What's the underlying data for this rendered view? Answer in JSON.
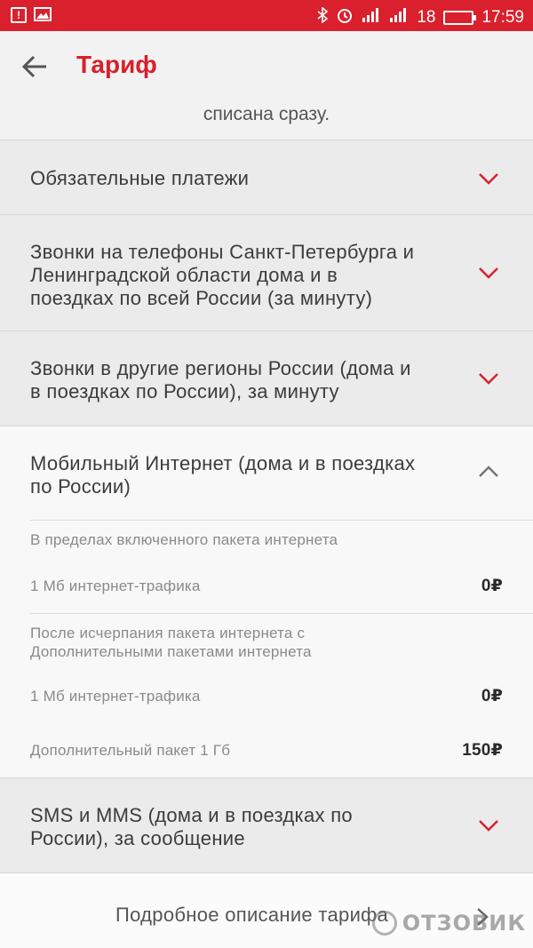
{
  "status_bar": {
    "signal": "18",
    "time": "17:59"
  },
  "header": {
    "title": "Тариф"
  },
  "cut_text": "списана сразу.",
  "sections": [
    {
      "label_line1": "Обязательные платежи",
      "label_line2": "",
      "label_line3": "",
      "state": "collapsed"
    },
    {
      "label_line1": "Звонки на телефоны Санкт-Петербурга и",
      "label_line2": "Ленинградской области дома и в",
      "label_line3": "поездках по всей России (за минуту)",
      "state": "collapsed"
    },
    {
      "label_line1": "Звонки в другие регионы России (дома и",
      "label_line2": "в поездках по России), за минуту",
      "label_line3": "",
      "state": "collapsed"
    },
    {
      "label_line1": "Мобильный Интернет (дома и в поездках",
      "label_line2": "по России)",
      "label_line3": "",
      "state": "expanded"
    },
    {
      "label_line1": "SMS и MMS (дома и в поездках по",
      "label_line2": "России), за сообщение",
      "label_line3": "",
      "state": "collapsed"
    }
  ],
  "internet_details": {
    "group1_title": "В пределах включенного пакета интернета",
    "group1_item_label": "1 Мб интернет-трафика",
    "group1_item_price": "0₽",
    "group2_title_line1": "После исчерпания пакета интернета с",
    "group2_title_line2": "Дополнительными пакетами интернета",
    "group2_item1_label": "1 Мб интернет-трафика",
    "group2_item1_price": "0₽",
    "group2_item2_label": "Дополнительный пакет 1 Гб",
    "group2_item2_price": "150₽"
  },
  "footer": {
    "link_label": "Подробное описание тарифа",
    "watermark": "ОТЗОВИК"
  },
  "colors": {
    "accent": "#d9202c",
    "chevron_collapsed": "#d9202c",
    "chevron_expanded": "#777777"
  }
}
